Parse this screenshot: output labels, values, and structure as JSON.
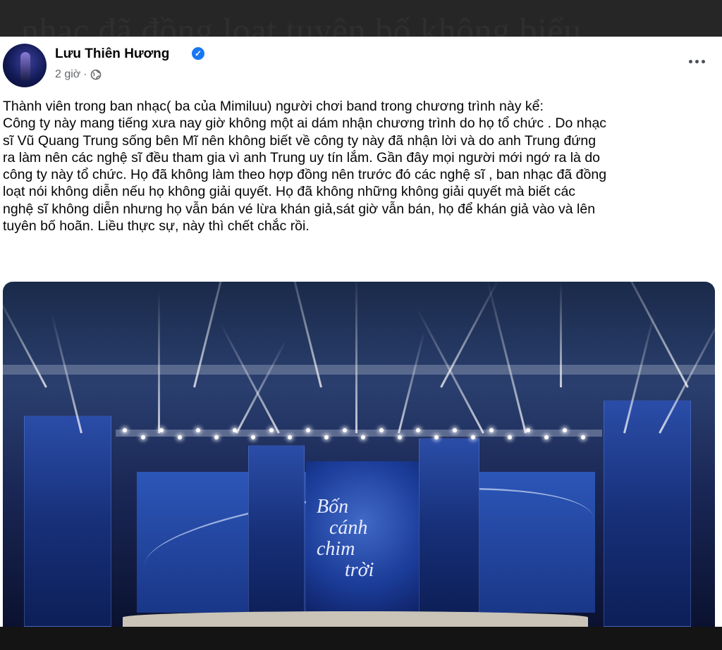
{
  "background_headline": "nhạc đã đồng loạt tuyên bố không biểu",
  "post": {
    "author": "Lưu Thiên Hương",
    "time": "2 giờ",
    "separator": "·",
    "paragraphs": [
      "Thành viên trong ban nhạc( ba của Mimiluu) người chơi band trong chương trình này  kể:",
      "Công ty này mang tiếng xưa nay giờ không một ai dám nhận chương trình do họ tổ chức . Do nhạc",
      "sĩ Vũ Quang Trung sống bên Mĩ nên không biết về công ty này đã nhận lời và do anh Trung đứng",
      "ra làm nên các nghệ sĩ đều tham gia vì anh Trung uy tín lắm. Gần đây mọi người mới ngớ ra là do",
      "công ty này tổ chức. Họ đã không làm theo hợp đồng nên trước đó các nghệ sĩ , ban nhạc đã đồng",
      "loạt nói không diễn  nếu họ không giải quyết. Họ đã không những không giải quyết mà biết các",
      "nghệ sĩ không diễn nhưng họ vẫn bán vé lừa khán giả,sát giờ vẫn bán, họ để khán giả vào và lên",
      "tuyên bố hoãn. Liều thực sự, này thì chết chắc rồi."
    ],
    "photo_title_lines": [
      "Bốn",
      "cánh",
      "chim",
      "trời"
    ]
  },
  "icons": {
    "verified": "verified-badge-icon",
    "audience": "globe-icon",
    "more": "more-options-icon"
  },
  "colors": {
    "brand_blue": "#1877f2",
    "text": "#050505",
    "meta": "#65676b"
  }
}
